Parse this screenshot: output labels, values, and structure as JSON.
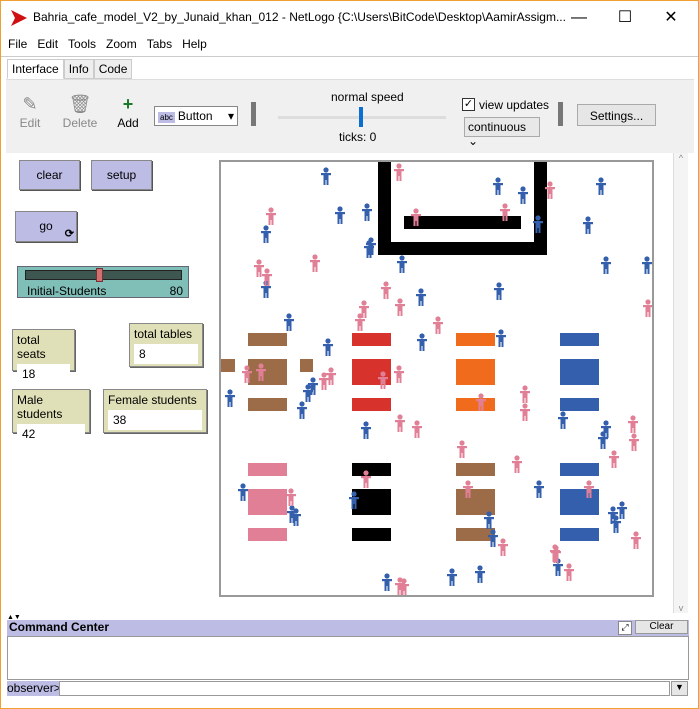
{
  "window": {
    "title": "Bahria_cafe_model_V2_by_Junaid_khan_012 - NetLogo {C:\\Users\\BitCode\\Desktop\\AamirAssigm...",
    "minimize": "—",
    "maximize": "☐",
    "close": "✕"
  },
  "menu": [
    "File",
    "Edit",
    "Tools",
    "Zoom",
    "Tabs",
    "Help"
  ],
  "tabs": [
    "Interface",
    "Info",
    "Code"
  ],
  "toolbar": {
    "edit": "Edit",
    "delete": "Delete",
    "add": "Add",
    "widget_type": "Button",
    "speed_label": "normal speed",
    "ticks": "ticks: 0",
    "view_updates": "view updates",
    "view_updates_checked": true,
    "update_mode": "continuous",
    "settings": "Settings..."
  },
  "widgets": {
    "clear": "clear",
    "setup": "setup",
    "go": "go",
    "slider": {
      "label": "Initial-Students",
      "value": "80",
      "fraction": 0.47
    },
    "monitors": [
      {
        "label": "total seats",
        "value": "18"
      },
      {
        "label": "total tables",
        "value": "8"
      },
      {
        "label": "Male students",
        "value": "42"
      },
      {
        "label": "Female students",
        "value": "38"
      }
    ]
  },
  "world": {
    "colors": {
      "male": "#345fac",
      "female": "#e07f96",
      "counter": "#000000"
    },
    "tables_row1": [
      "#9c6b47",
      "#d7322b",
      "#f06c1c",
      "#345fac"
    ],
    "tables_row2": [
      "#e07f96",
      "#000000",
      "#9c6b47",
      "#345fac"
    ]
  },
  "command_center": {
    "title": "Command Center",
    "clear": "Clear",
    "prompt": "observer>"
  }
}
